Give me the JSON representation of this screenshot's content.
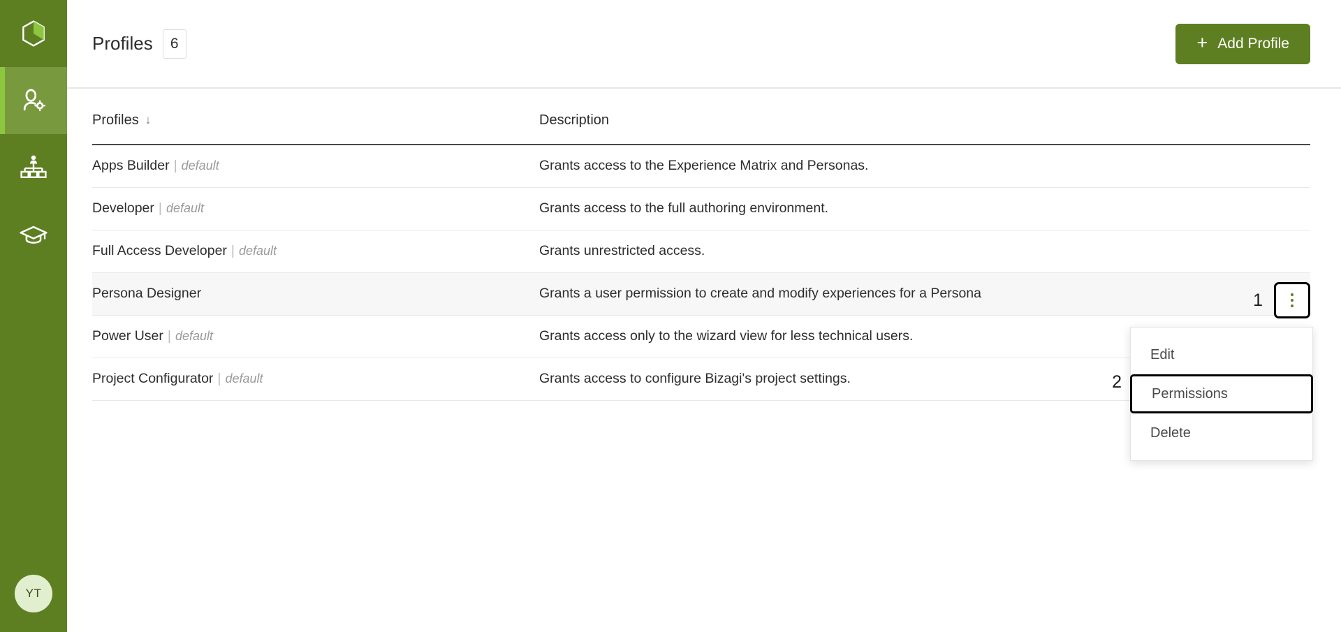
{
  "sidebar": {
    "logo": {
      "icon": "cube-logo-icon",
      "label": "Bizagi"
    },
    "items": [
      {
        "id": "users-profiles",
        "icon": "user-gear-icon",
        "label": "Users and profiles",
        "active": true
      },
      {
        "id": "organization",
        "icon": "org-chart-icon",
        "label": "Organization",
        "active": false
      },
      {
        "id": "learning",
        "icon": "graduation-cap-icon",
        "label": "Learning",
        "active": false
      }
    ],
    "avatar": {
      "initials": "YT",
      "bg": "#e2efcf",
      "fg": "#3d4a24"
    }
  },
  "header": {
    "title": "Profiles",
    "count": "6",
    "add_button": {
      "label": "Add Profile",
      "icon": "plus-icon",
      "bg": "#5d7f22"
    }
  },
  "table": {
    "columns": [
      {
        "key": "name",
        "label": "Profiles",
        "sort": "↓",
        "sorted": true
      },
      {
        "key": "description",
        "label": "Description",
        "sort": "",
        "sorted": false
      }
    ],
    "rows": [
      {
        "name": "Apps Builder",
        "default_tag": "default",
        "is_default": true,
        "description": "Grants access to the Experience Matrix and Personas.",
        "highlight": false
      },
      {
        "name": "Developer",
        "default_tag": "default",
        "is_default": true,
        "description": "Grants access to the full authoring environment.",
        "highlight": false
      },
      {
        "name": "Full Access Developer",
        "default_tag": "default",
        "is_default": true,
        "description": "Grants unrestricted access.",
        "highlight": false
      },
      {
        "name": "Persona Designer",
        "default_tag": "",
        "is_default": false,
        "description": "Grants a user permission to create and modify experiences for a Persona",
        "highlight": true
      },
      {
        "name": "Power User",
        "default_tag": "default",
        "is_default": true,
        "description": "Grants access only to the wizard view for less technical users.",
        "highlight": false
      },
      {
        "name": "Project Configurator",
        "default_tag": "default",
        "is_default": true,
        "description": "Grants access to configure Bizagi's project settings.",
        "highlight": false
      }
    ]
  },
  "row_actions": {
    "kebab": {
      "icon": "kebab-menu-icon",
      "dot_color": "#5d7f22"
    },
    "menu": [
      {
        "id": "edit",
        "label": "Edit",
        "boxed": false
      },
      {
        "id": "permissions",
        "label": "Permissions",
        "boxed": true
      },
      {
        "id": "delete",
        "label": "Delete",
        "boxed": false
      }
    ]
  },
  "annotations": {
    "step1": "1",
    "step2": "2"
  }
}
